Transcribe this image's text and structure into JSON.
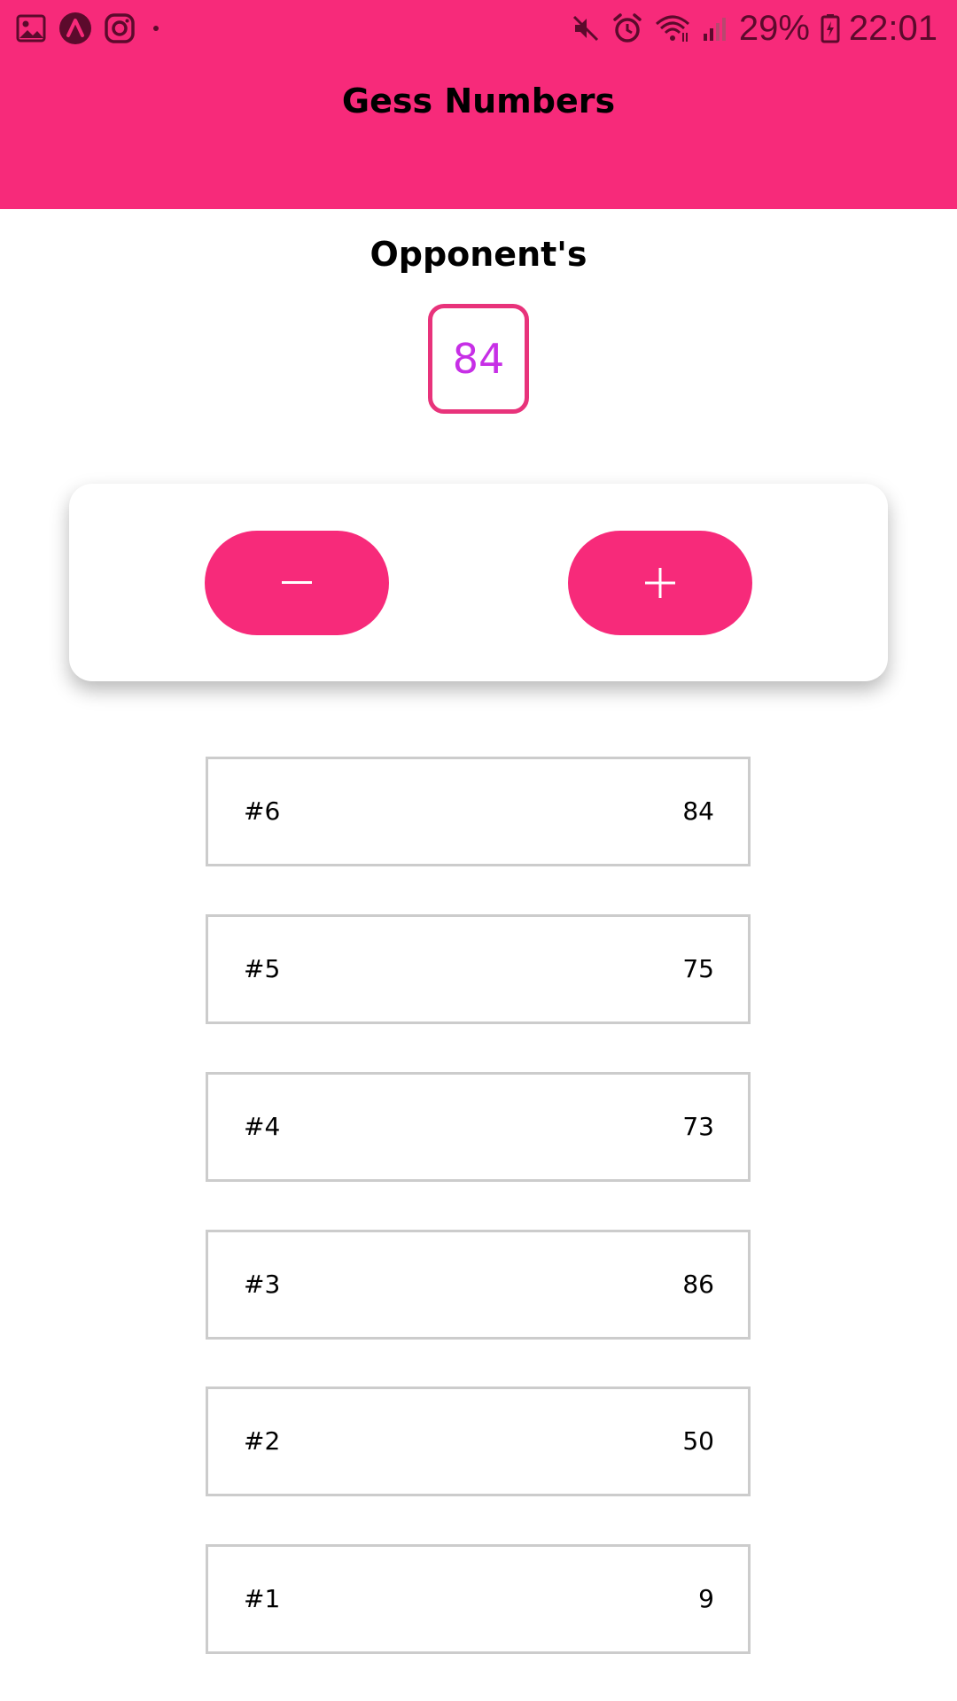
{
  "status_bar": {
    "left_icons": [
      "gallery-icon",
      "app-logo-icon",
      "instagram-icon",
      "dot-icon"
    ],
    "right_icons": [
      "mute-icon",
      "alarm-icon",
      "wifi-icon",
      "signal-icon"
    ],
    "battery": "29%",
    "time": "22:01"
  },
  "header": {
    "title": "Gess Numbers"
  },
  "opponent": {
    "label": "Opponent's",
    "guess": "84"
  },
  "controls": {
    "minus_label": "−",
    "plus_label": "+"
  },
  "guesses": [
    {
      "index": "#6",
      "value": "84"
    },
    {
      "index": "#5",
      "value": "75"
    },
    {
      "index": "#4",
      "value": "73"
    },
    {
      "index": "#3",
      "value": "86"
    },
    {
      "index": "#2",
      "value": "50"
    },
    {
      "index": "#1",
      "value": "9"
    }
  ],
  "colors": {
    "primary": "#f72a7a",
    "number_border": "#e8337b",
    "number_text": "#c72fe6",
    "row_border": "#cccccc"
  }
}
